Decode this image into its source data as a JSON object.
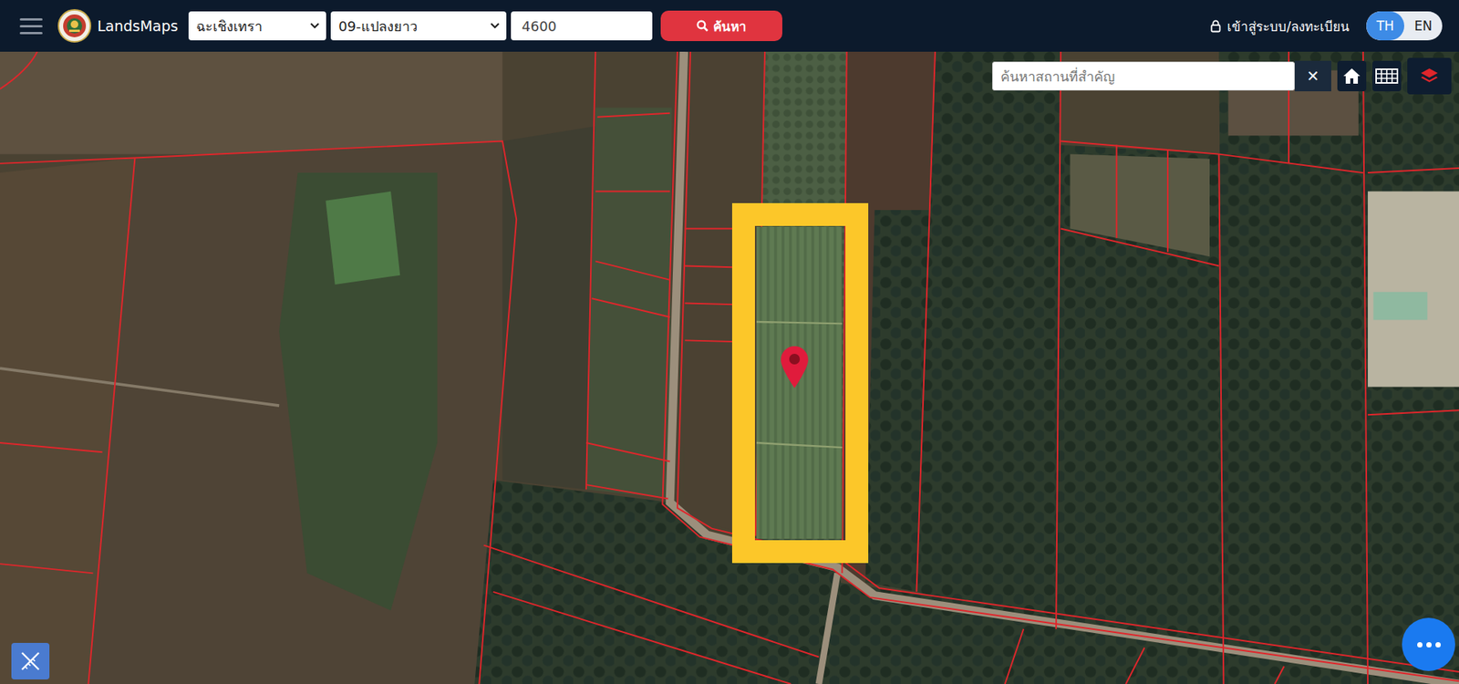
{
  "header": {
    "logo": "LandsMaps",
    "province": "ฉะเชิงเทรา",
    "district": "09-แปลงยาว",
    "parcel_number": "4600",
    "search_button": "ค้นหา",
    "login": "เข้าสู่ระบบ/ลงทะเบียน",
    "languages": [
      {
        "label": "TH",
        "selected": true
      },
      {
        "label": "EN",
        "selected": false
      }
    ]
  },
  "map": {
    "place_search": {
      "placeholder": "ค้นหาสถานที่สำคัญ"
    },
    "clear_button": "✕"
  }
}
